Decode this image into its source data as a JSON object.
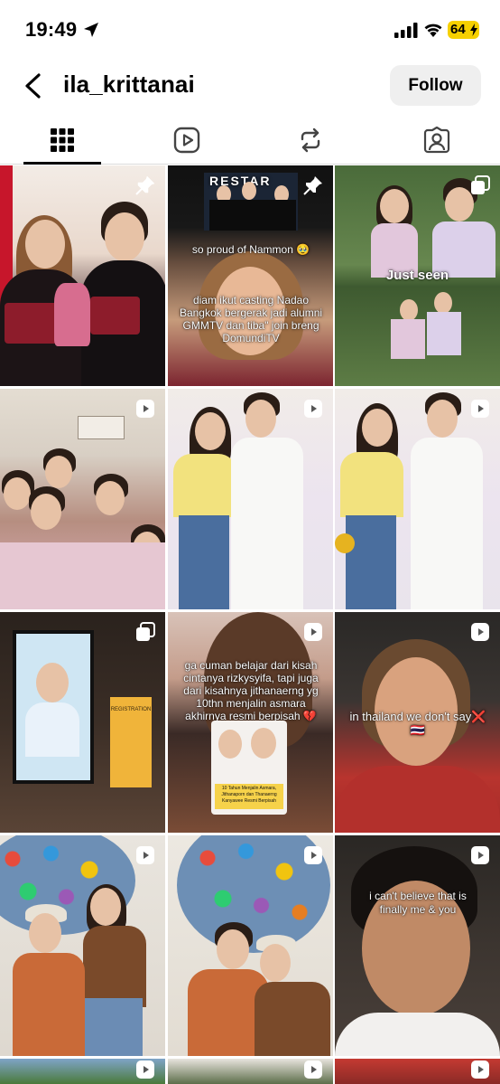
{
  "status_bar": {
    "time": "19:49",
    "battery_percent": "64",
    "icons": [
      "location-arrow-icon",
      "cellular-signal-icon",
      "wifi-icon",
      "battery-charging-icon"
    ]
  },
  "header": {
    "username": "ila_krittanai",
    "follow_label": "Follow",
    "back_icon": "chevron-left-icon"
  },
  "tabs": [
    {
      "name": "grid",
      "icon": "grid-icon",
      "active": true
    },
    {
      "name": "reels",
      "icon": "reels-play-icon",
      "active": false
    },
    {
      "name": "reposts",
      "icon": "repost-icon",
      "active": false
    },
    {
      "name": "tagged",
      "icon": "tagged-person-icon",
      "active": false
    }
  ],
  "posts": [
    {
      "icon": "pin-icon",
      "captions": []
    },
    {
      "icon": "pin-icon",
      "captions": [
        "RESTAR",
        "so proud of Nammon 🥹",
        "diam ikut casting Nadao Bangkok bergerak jadi alumni GMMTV dan tiba\" join breng DomundiTV"
      ]
    },
    {
      "icon": "carousel-icon",
      "captions": [
        "Just seen"
      ]
    },
    {
      "icon": "reel-icon",
      "captions": []
    },
    {
      "icon": "reel-icon",
      "captions": []
    },
    {
      "icon": "reel-icon",
      "captions": []
    },
    {
      "icon": "carousel-icon",
      "captions": [
        "REGISTRATION"
      ]
    },
    {
      "icon": "reel-icon",
      "captions": [
        "ga cuman belajar dari kisah cintanya rizkysyifa, tapi juga dari kisahnya jithanaerng yg 10thn menjalin asmara akhirnya resmi berpisah 💔",
        "10 Tahun Menjalin Asmara, Jithanaporn dan Thanaerng Kanyawee Resmi Berpisah"
      ]
    },
    {
      "icon": "reel-icon",
      "captions": [
        "in thailand we don't say❌🇹🇭"
      ]
    },
    {
      "icon": "reel-icon",
      "captions": []
    },
    {
      "icon": "reel-icon",
      "captions": []
    },
    {
      "icon": "reel-icon",
      "captions": [
        "i can't believe that is finally me & you"
      ]
    },
    {
      "icon": "reel-icon",
      "captions": []
    },
    {
      "icon": "reel-icon",
      "captions": []
    },
    {
      "icon": "reel-icon",
      "captions": []
    }
  ]
}
